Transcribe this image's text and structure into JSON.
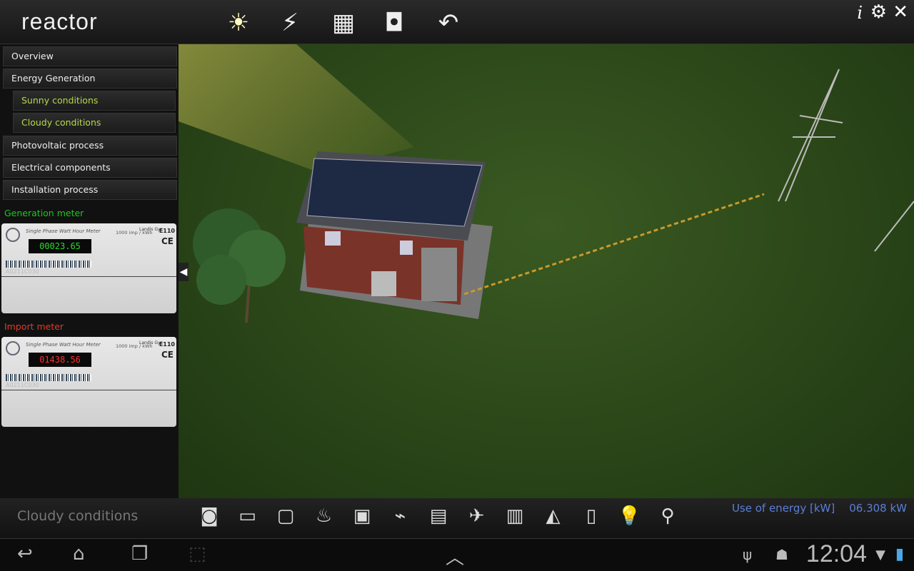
{
  "header": {
    "logo": "reactor",
    "toolbar": [
      {
        "icon": "sun-cloud-icon",
        "glyph": "☀"
      },
      {
        "icon": "lightning-icon",
        "glyph": "⚡"
      },
      {
        "icon": "solar-panel-icon",
        "glyph": "▦"
      },
      {
        "icon": "meter-icon",
        "glyph": "◘"
      },
      {
        "icon": "panel-rotate-icon",
        "glyph": "↶"
      }
    ],
    "info": "i",
    "gear": "⚙",
    "close": "✕"
  },
  "sidebar": {
    "items": [
      {
        "label": "Overview"
      },
      {
        "label": "Energy Generation"
      },
      {
        "label": "Sunny conditions",
        "sub": true
      },
      {
        "label": "Cloudy conditions",
        "sub": true
      },
      {
        "label": "Photovoltaic process"
      },
      {
        "label": "Electrical components"
      },
      {
        "label": "Installation process"
      }
    ],
    "generation_meter": {
      "label": "Generation meter",
      "label_color": "#1ec81e",
      "title": "Single Phase Watt Hour Meter",
      "brand": "Landis Gyr",
      "model": "E110",
      "imp": "1000 imp / kWh",
      "reading": "00023.65",
      "reading_color": "#2ed62e",
      "ce": "CE",
      "serial": "A0211C030"
    },
    "import_meter": {
      "label": "Import meter",
      "label_color": "#e03a2a",
      "title": "Single Phase Watt Hour Meter",
      "brand": "Landis Gyr",
      "model": "E110",
      "imp": "1000 imp / kWh",
      "reading": "01438.56",
      "reading_color": "#ff3030",
      "ce": "CE",
      "serial": "A0211C030"
    }
  },
  "bottom": {
    "condition": "Cloudy conditions",
    "appliances": [
      {
        "icon": "washing-machine-icon",
        "glyph": "◙"
      },
      {
        "icon": "microwave-icon",
        "glyph": "▭"
      },
      {
        "icon": "tv-icon",
        "glyph": "▢"
      },
      {
        "icon": "kettle-icon",
        "glyph": "♨"
      },
      {
        "icon": "computer-icon",
        "glyph": "▣"
      },
      {
        "icon": "vacuum-icon",
        "glyph": "⌁"
      },
      {
        "icon": "dishwasher-icon",
        "glyph": "▤"
      },
      {
        "icon": "hairdryer-icon",
        "glyph": "✈"
      },
      {
        "icon": "oven-icon",
        "glyph": "▥"
      },
      {
        "icon": "iron-icon",
        "glyph": "◭"
      },
      {
        "icon": "fridge-icon",
        "glyph": "▯"
      },
      {
        "icon": "lightbulb-icon",
        "glyph": "💡"
      },
      {
        "icon": "energy-saving-bulb-icon",
        "glyph": "⚲"
      }
    ],
    "use_label": "Use of energy [kW]",
    "use_value": "06.308 kW"
  },
  "system": {
    "back": "↩",
    "home": "⌂",
    "recent": "❐",
    "screenshot": "⬚",
    "up": "︿",
    "usb": "ψ",
    "android": "☗",
    "time": "12:04",
    "wifi": "▼",
    "battery": "▮"
  }
}
